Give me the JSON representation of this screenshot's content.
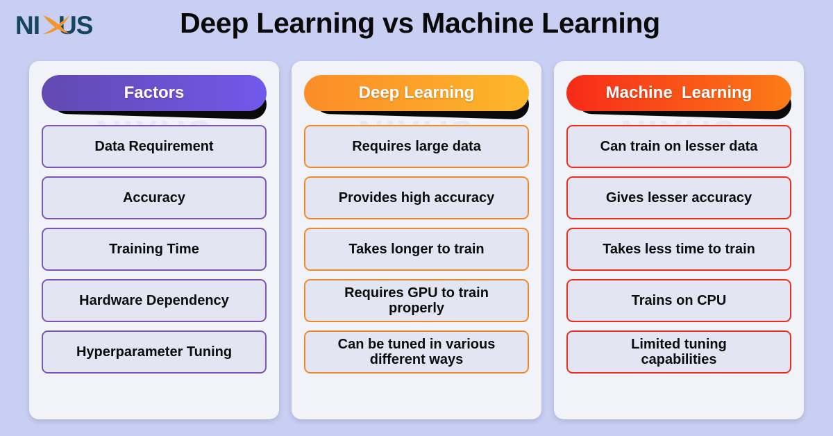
{
  "brand": {
    "logo_text_1": "NI",
    "logo_text_2": "US",
    "logo_name": "NIXUS",
    "logo_color_dark": "#14465c",
    "logo_color_accent": "#f0962c"
  },
  "header": {
    "title": "Deep Learning vs Machine Learning"
  },
  "watermark": {
    "text": "NIXUS"
  },
  "colors": {
    "page_background": "#c9cff2",
    "card_background": "#f2f3f8",
    "row_background": "#e3e5f2",
    "factors_border": "#7b54b5",
    "deep_learning_border": "#ef8a2c",
    "machine_learning_border": "#ee2d1c",
    "factors_gradient_from": "#6349b0",
    "factors_gradient_to": "#7158ea",
    "deep_learning_gradient_from": "#fb8c28",
    "deep_learning_gradient_to": "#fdb72b",
    "machine_learning_gradient_from": "#f72a18",
    "machine_learning_gradient_to": "#fb7c17",
    "pill_shadow": "#090909",
    "title_text": "#0a0a0a",
    "row_text": "#0c0c0c",
    "pill_text": "#ffffff"
  },
  "chart_data": {
    "type": "table",
    "title": "Deep Learning vs Machine Learning",
    "columns": [
      "Factors",
      "Deep Learning",
      "Machine  Learning"
    ],
    "rows": [
      [
        "Data Requirement",
        "Requires large data",
        "Can train on lesser data"
      ],
      [
        "Accuracy",
        "Provides high accuracy",
        "Gives lesser accuracy"
      ],
      [
        "Training Time",
        "Takes longer to train",
        "Takes less time to train"
      ],
      [
        "Hardware Dependency",
        "Requires GPU to train properly",
        "Trains on CPU"
      ],
      [
        "Hyperparameter Tuning",
        "Can be tuned in various different ways",
        "Limited tuning capabilities"
      ]
    ]
  },
  "columns": [
    {
      "id": "factors",
      "header": "Factors",
      "rows": [
        {
          "line1": "Data Requirement",
          "line2": ""
        },
        {
          "line1": "Accuracy",
          "line2": ""
        },
        {
          "line1": "Training Time",
          "line2": ""
        },
        {
          "line1": "Hardware Dependency",
          "line2": ""
        },
        {
          "line1": "Hyperparameter Tuning",
          "line2": ""
        }
      ]
    },
    {
      "id": "deep_learning",
      "header": "Deep Learning",
      "rows": [
        {
          "line1": "Requires large data",
          "line2": ""
        },
        {
          "line1": "Provides high accuracy",
          "line2": ""
        },
        {
          "line1": "Takes longer to train",
          "line2": ""
        },
        {
          "line1": "Requires GPU to train",
          "line2": "properly"
        },
        {
          "line1": "Can be tuned in various",
          "line2": "different ways"
        }
      ]
    },
    {
      "id": "machine_learning",
      "header": "Machine  Learning",
      "rows": [
        {
          "line1": "Can train on lesser data",
          "line2": ""
        },
        {
          "line1": "Gives lesser accuracy",
          "line2": ""
        },
        {
          "line1": "Takes less time to train",
          "line2": ""
        },
        {
          "line1": "Trains on CPU",
          "line2": ""
        },
        {
          "line1": "Limited tuning",
          "line2": "capabilities"
        }
      ]
    }
  ]
}
